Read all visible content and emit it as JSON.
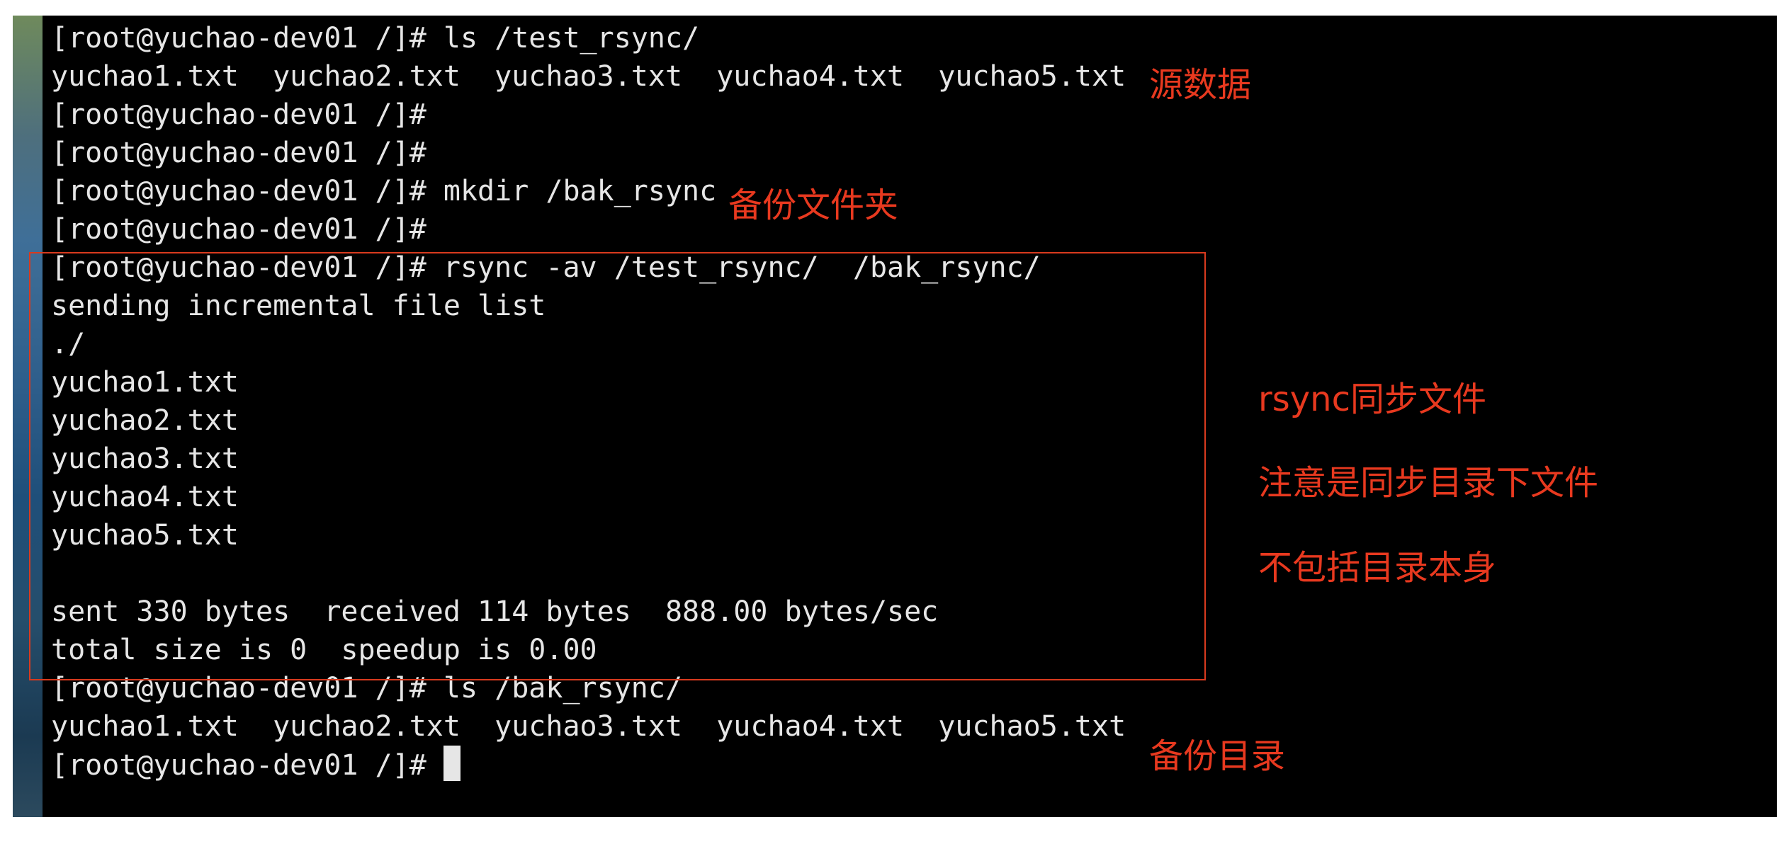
{
  "top_fragment": "            ",
  "terminal": {
    "lines": [
      "[root@yuchao-dev01 /]# ls /test_rsync/",
      "yuchao1.txt  yuchao2.txt  yuchao3.txt  yuchao4.txt  yuchao5.txt",
      "[root@yuchao-dev01 /]#",
      "[root@yuchao-dev01 /]#",
      "[root@yuchao-dev01 /]# mkdir /bak_rsync",
      "[root@yuchao-dev01 /]#",
      "[root@yuchao-dev01 /]# rsync -av /test_rsync/  /bak_rsync/",
      "sending incremental file list",
      "./",
      "yuchao1.txt",
      "yuchao2.txt",
      "yuchao3.txt",
      "yuchao4.txt",
      "yuchao5.txt",
      "",
      "sent 330 bytes  received 114 bytes  888.00 bytes/sec",
      "total size is 0  speedup is 0.00",
      "[root@yuchao-dev01 /]# ls /bak_rsync/",
      "yuchao1.txt  yuchao2.txt  yuchao3.txt  yuchao4.txt  yuchao5.txt",
      "[root@yuchao-dev01 /]# "
    ]
  },
  "annotations": {
    "source_data": "源数据",
    "backup_folder": "备份文件夹",
    "rsync_sync_files": "rsync同步文件",
    "note_sync_contents": "注意是同步目录下文件",
    "excludes_dir_itself": "不包括目录本身",
    "backup_dir": "备份目录"
  },
  "colors": {
    "terminal_bg": "#000000",
    "terminal_text": "#e6e6e6",
    "annotation": "#e8391f",
    "box_border": "#d83a1e"
  }
}
